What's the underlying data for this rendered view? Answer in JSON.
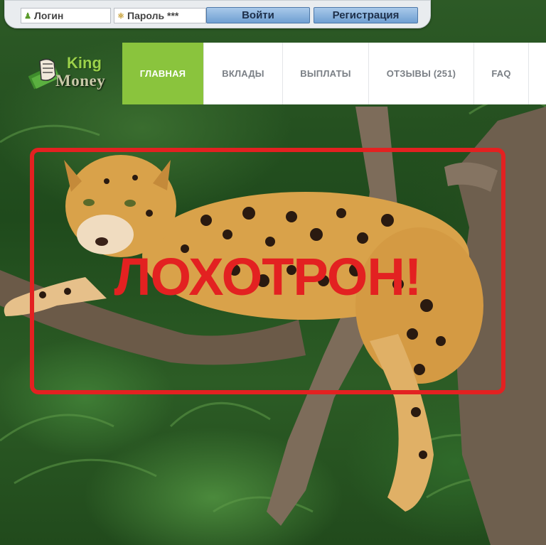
{
  "login_bar": {
    "login_placeholder": "Логин",
    "login_icon": "user-icon",
    "password_placeholder": "Пароль ***",
    "password_icon": "key-icon",
    "login_button": "Войти",
    "register_button": "Регистрация"
  },
  "logo": {
    "line1": "King",
    "line2": "Money",
    "icon": "fist-with-cash-icon"
  },
  "nav": {
    "items": [
      {
        "label": "ГЛАВНАЯ",
        "active": true
      },
      {
        "label": "ВКЛАДЫ",
        "active": false
      },
      {
        "label": "ВЫПЛАТЫ",
        "active": false
      },
      {
        "label": "ОТЗЫВЫ (251)",
        "active": false
      },
      {
        "label": "FAQ",
        "active": false
      }
    ]
  },
  "overlay": {
    "stamp_text": "ЛОХОТРОН!",
    "color": "#e32121"
  },
  "colors": {
    "nav_active": "#8ac43d",
    "button_blue": "#6f9fd2"
  }
}
